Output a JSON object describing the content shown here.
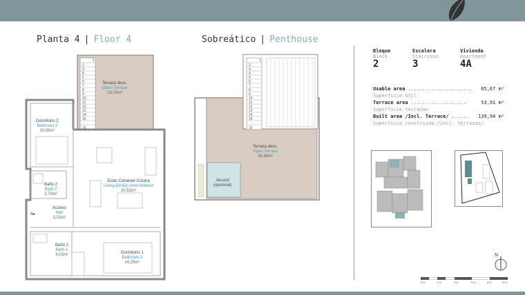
{
  "header": {
    "floor4": {
      "es": "Planta 4",
      "sep": "|",
      "en": "Floor 4"
    },
    "penthouse": {
      "es": "Sobreático",
      "sep": "|",
      "en": "Penthouse"
    }
  },
  "rooms": {
    "terrace_floor4": {
      "es": "Terraza desc.",
      "en": "Open Terrace",
      "area": "16,93m²"
    },
    "bedroom2": {
      "es": "Dormitorio 2",
      "en": "Bedroom 2",
      "area": "10,08m²"
    },
    "living": {
      "es": "Estar-Comedor-Cocina",
      "en": "Living-Dining room-Kitchen",
      "area": "30,62m²"
    },
    "bath2": {
      "es": "Baño 2",
      "en": "Bath 2",
      "area": "3,70m²"
    },
    "hall": {
      "es": "Acceso",
      "en": "Hall",
      "area": "3,02m²"
    },
    "bath1": {
      "es": "Baño 1",
      "en": "Bath 1",
      "area": "4,03m²"
    },
    "bedroom1": {
      "es": "Dormitorio 1",
      "en": "Bedroom 1",
      "area": "14,25m²"
    },
    "terrace_penthouse": {
      "es": "Terraza desc.",
      "en": "Open Terrace",
      "area": "36,98m²"
    },
    "jacuzzi": {
      "es": "Jacuzzi",
      "note": "(opcional)"
    }
  },
  "entrance_marker": "A",
  "stairs_floor4": [
    "1",
    "2",
    "3",
    "4",
    "5",
    "6",
    "7",
    "8",
    "9",
    "10",
    "11",
    "12",
    "13",
    "14",
    "15",
    "16"
  ],
  "stairs_penthouse": [
    "1",
    "2",
    "3",
    "4",
    "5",
    "6",
    "7",
    "8",
    "9",
    "10",
    "11",
    "12",
    "13",
    "14",
    "15",
    "16"
  ],
  "unit": {
    "block": {
      "es": "Bloque",
      "en": "Block",
      "value": "2"
    },
    "staircase": {
      "es": "Escalera",
      "en": "Staircase",
      "value": "3"
    },
    "apartment": {
      "es": "Vivienda",
      "en": "Apartment",
      "value": "4A"
    }
  },
  "areas": {
    "usable": {
      "label": "Usable area",
      "dots": "......................",
      "value": "65,67 m²",
      "sub": "Superficie útil"
    },
    "terrace": {
      "label": "Terrace area",
      "dots": "...................",
      "value": "53,91 m²",
      "sub": "Superficie terrazas"
    },
    "built": {
      "label": "Built area /Incl. Terrace/",
      "dots": "......",
      "value": "139,94 m²",
      "sub": "Superficie construida /incl. terrazas/"
    }
  },
  "north_label": "N",
  "scale_labels": [
    "0 m",
    "1 m",
    "2 m",
    "3 m",
    "4 m",
    "5 m"
  ],
  "colors": {
    "accent": "#7ab0bb",
    "bar": "#7f969a",
    "terrace": "#d9cdc3",
    "jacuzzi": "#cfe4e6"
  }
}
